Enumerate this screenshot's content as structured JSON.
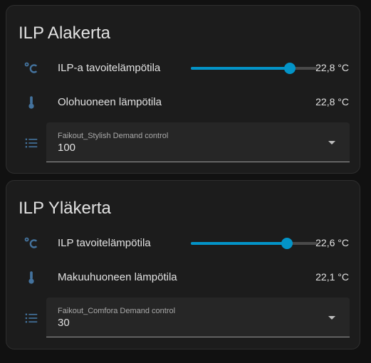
{
  "cards": [
    {
      "title": "ILP Alakerta",
      "setpoint": {
        "icon": "celsius-icon",
        "label": "ILP-a tavoitelämpötila",
        "value": "22,8 °C",
        "slider_fraction": 0.78
      },
      "sensor": {
        "icon": "thermometer-icon",
        "label": "Olohuoneen lämpötila",
        "value": "22,8 °C"
      },
      "select": {
        "icon": "list-icon",
        "label": "Faikout_Stylish Demand control",
        "value": "100"
      }
    },
    {
      "title": "ILP Yläkerta",
      "setpoint": {
        "icon": "celsius-icon",
        "label": "ILP tavoitelämpötila",
        "value": "22,6 °C",
        "slider_fraction": 0.76
      },
      "sensor": {
        "icon": "thermometer-icon",
        "label": "Makuuhuoneen lämpötila",
        "value": "22,1 °C"
      },
      "select": {
        "icon": "list-icon",
        "label": "Faikout_Comfora Demand control",
        "value": "30"
      }
    }
  ],
  "colors": {
    "accent": "#0394c8",
    "icon": "#44739e",
    "card_bg": "#1c1c1c",
    "page_bg": "#111111"
  }
}
